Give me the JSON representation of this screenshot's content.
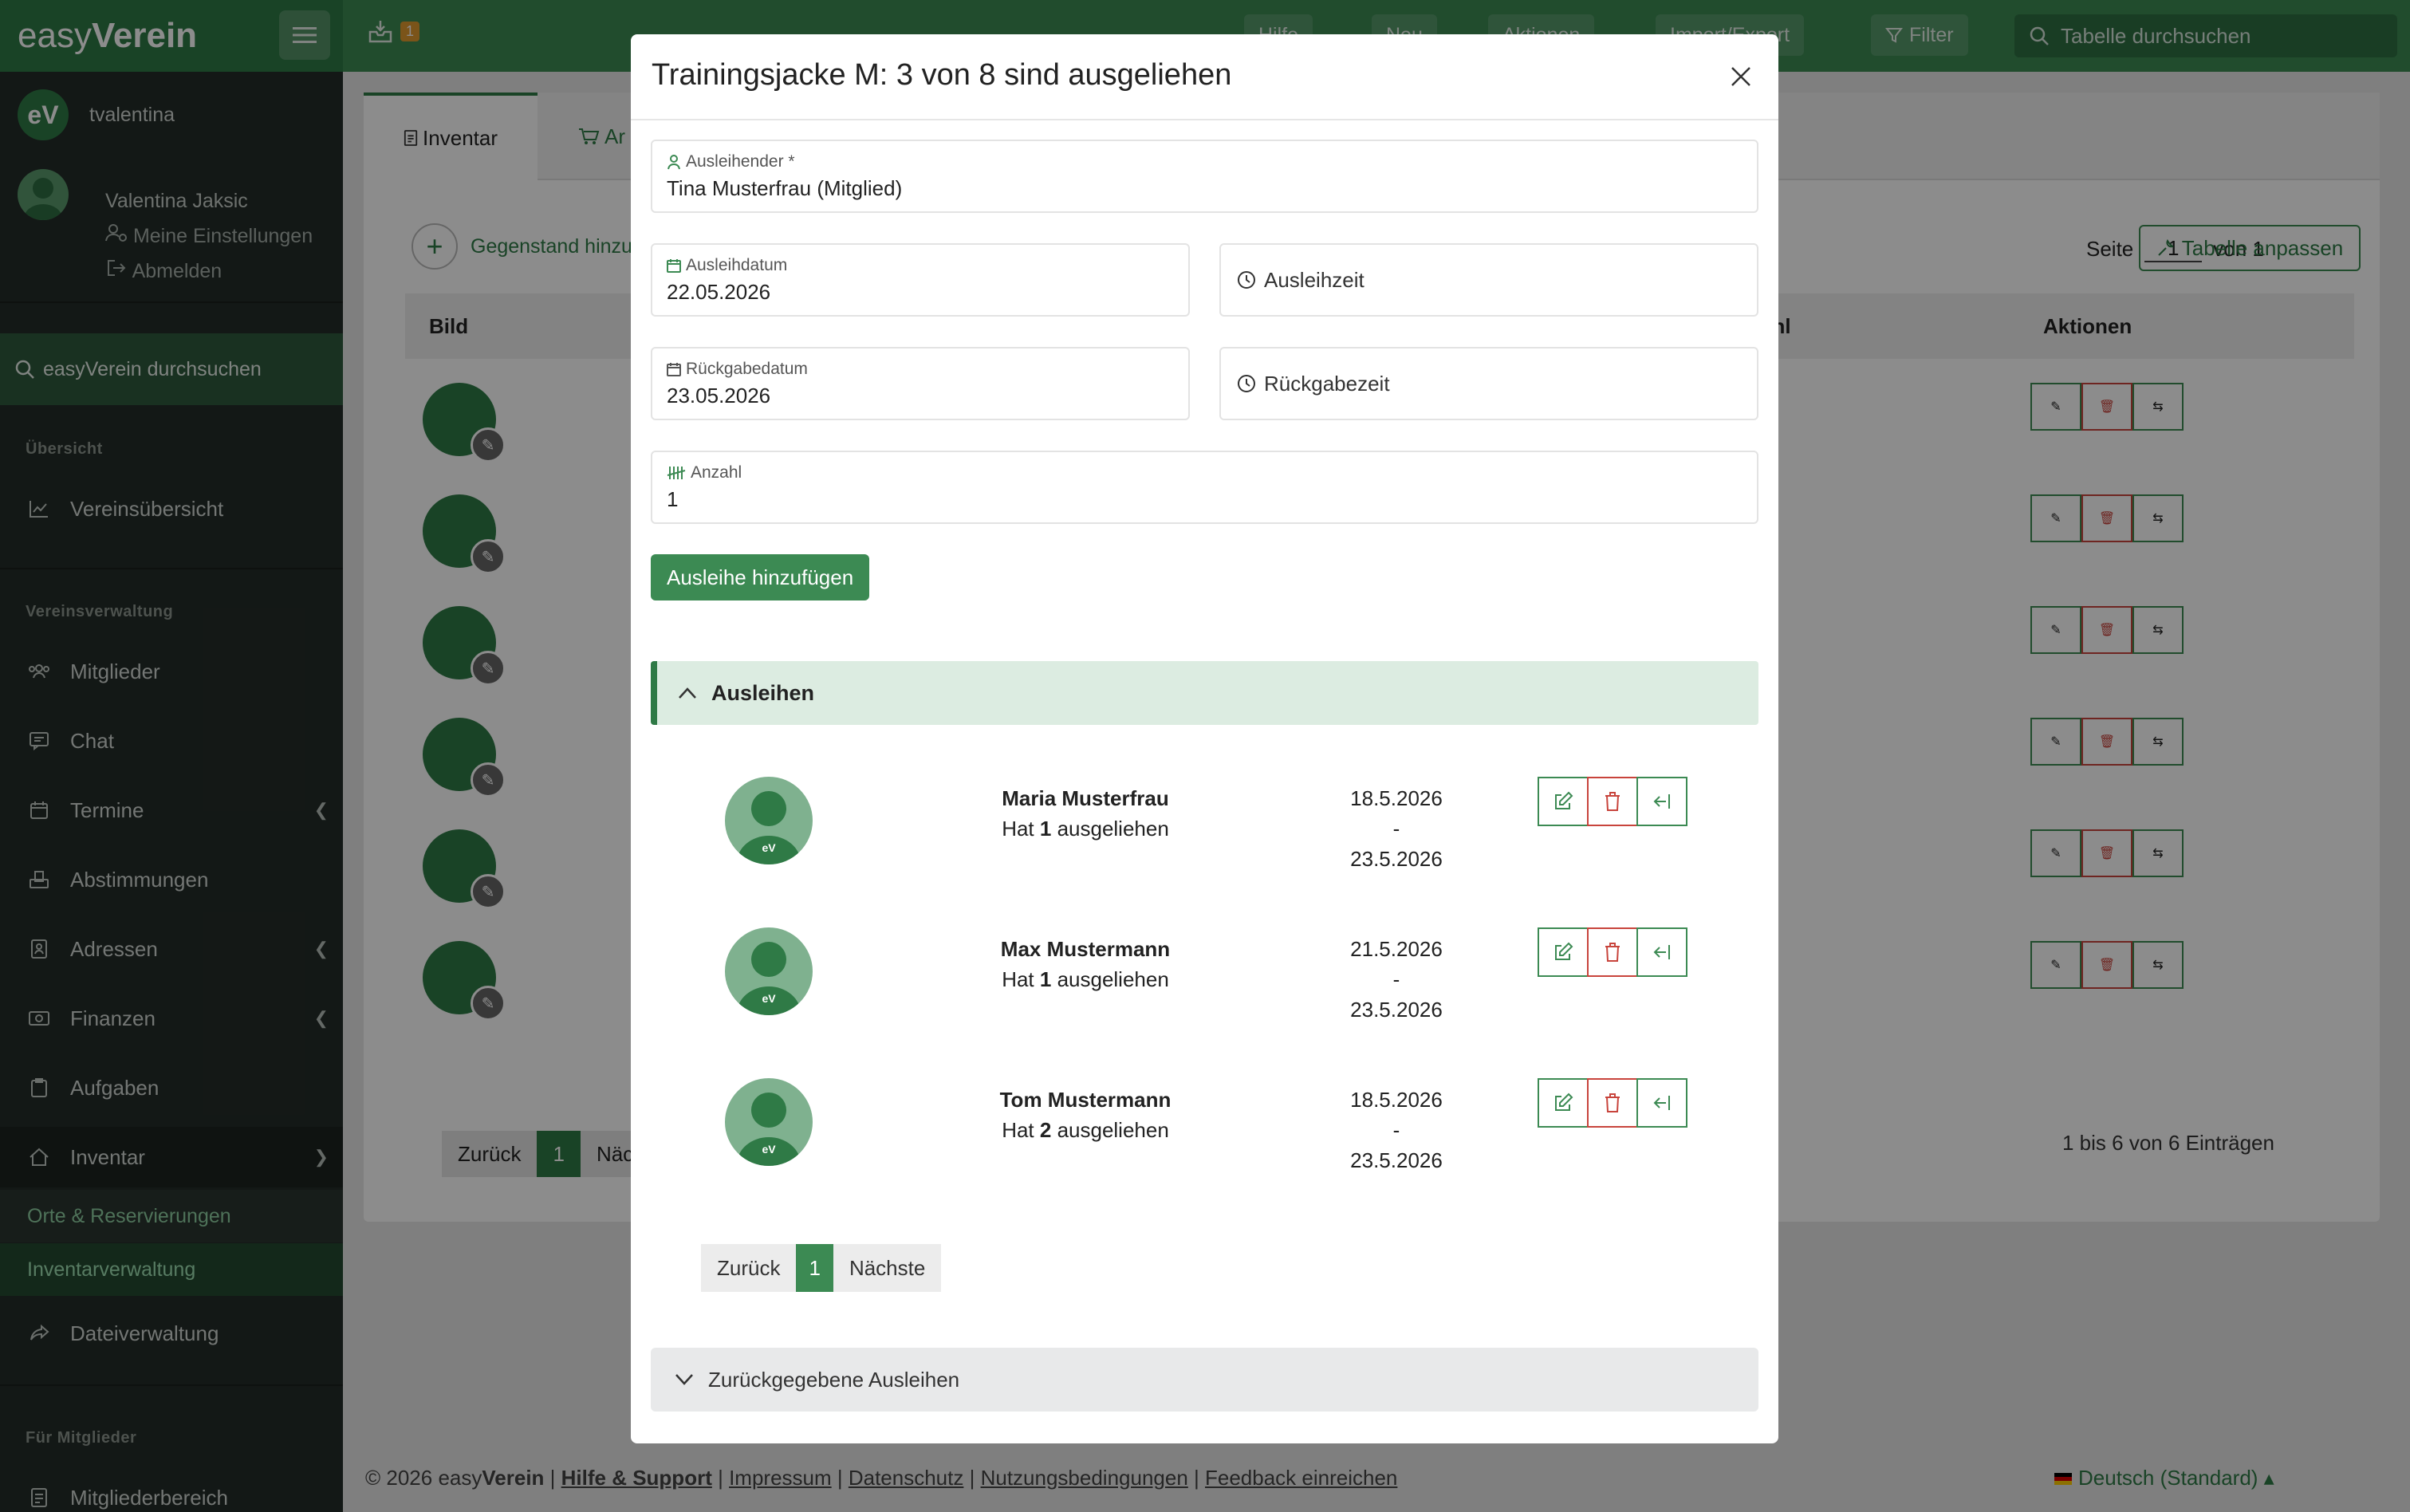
{
  "sidebar": {
    "brand_light": "easy",
    "brand_bold": "Verein",
    "account_initials": "eV",
    "account_name": "tvalentina",
    "user_name": "Valentina Jaksic",
    "settings_label": "Meine Einstellungen",
    "logout_label": "Abmelden",
    "search_label": "easyVerein durchsuchen",
    "section_overview": "Übersicht",
    "section_management": "Vereinsverwaltung",
    "section_members": "Für Mitglieder",
    "items": [
      {
        "label": "Vereinsübersicht"
      },
      {
        "label": "Mitglieder"
      },
      {
        "label": "Chat"
      },
      {
        "label": "Termine"
      },
      {
        "label": "Abstimmungen"
      },
      {
        "label": "Adressen"
      },
      {
        "label": "Finanzen"
      },
      {
        "label": "Aufgaben"
      },
      {
        "label": "Inventar"
      },
      {
        "label": "Dateiverwaltung"
      },
      {
        "label": "Mitgliederbereich"
      }
    ],
    "subitems": [
      {
        "label": "Orte & Reservierungen"
      },
      {
        "label": "Inventarverwaltung"
      }
    ]
  },
  "topbar": {
    "notification_count": "1",
    "help_label": "Hilfe",
    "new_label": "Neu",
    "actions_label": "Aktionen",
    "import_label": "Import/Export",
    "filter_label": "Filter",
    "search_placeholder": "Tabelle durchsuchen"
  },
  "main": {
    "tabs": [
      {
        "label": "Inventar"
      },
      {
        "label": "Ar"
      }
    ],
    "add_item_label": "Gegenstand hinzu",
    "page_label": "Seite",
    "page_value": "1",
    "page_of": "von 1",
    "customize_table_label": "Tabelle anpassen",
    "col_image": "Bild",
    "col_count": "ahl",
    "col_actions": "Aktionen",
    "pager_back": "Zurück",
    "pager_current": "1",
    "pager_next": "Näc",
    "entries_info": "1 bis 6 von 6 Einträgen"
  },
  "footer": {
    "copyright": "© 2026 easy",
    "copyright_bold": "Verein",
    "links": [
      "Hilfe & Support",
      "Impressum",
      "Datenschutz",
      "Nutzungsbedingungen",
      "Feedback einreichen"
    ],
    "language": "Deutsch (Standard)"
  },
  "modal": {
    "title": "Trainingsjacke M: 3 von 8 sind ausgeliehen",
    "borrower_label": "Ausleihender *",
    "borrower_value": "Tina Musterfrau (Mitglied)",
    "loan_date_label": "Ausleihdatum",
    "loan_date_value": "22.05.2026",
    "loan_time_label": "Ausleihzeit",
    "return_date_label": "Rückgabedatum",
    "return_date_value": "23.05.2026",
    "return_time_label": "Rückgabezeit",
    "amount_label": "Anzahl",
    "amount_value": "1",
    "add_button": "Ausleihe hinzufügen",
    "loans_heading": "Ausleihen",
    "loans": [
      {
        "name": "Maria Musterfrau",
        "pre": "Hat ",
        "count": "1",
        "post": " ausgeliehen",
        "from": "18.5.2026",
        "dash": "-",
        "to": "23.5.2026"
      },
      {
        "name": "Max Mustermann",
        "pre": "Hat ",
        "count": "1",
        "post": " ausgeliehen",
        "from": "21.5.2026",
        "dash": "-",
        "to": "23.5.2026"
      },
      {
        "name": "Tom Mustermann",
        "pre": "Hat ",
        "count": "2",
        "post": " ausgeliehen",
        "from": "18.5.2026",
        "dash": "-",
        "to": "23.5.2026"
      }
    ],
    "avatar_text": "eV",
    "pager_back": "Zurück",
    "pager_current": "1",
    "pager_next": "Nächste",
    "returned_heading": "Zurückgegebene Ausleihen"
  }
}
